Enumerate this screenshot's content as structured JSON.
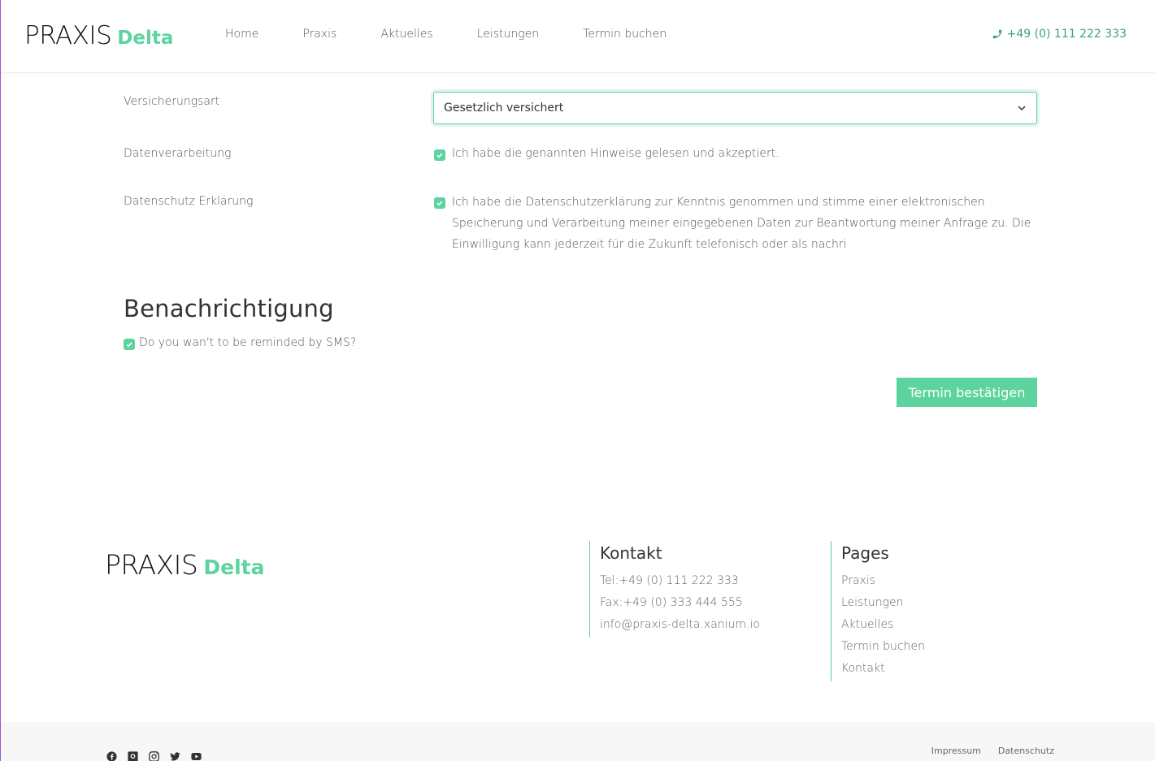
{
  "header": {
    "logo_word1": "PRAXIS",
    "logo_word2": "Delta",
    "nav": [
      "Home",
      "Praxis",
      "Aktuelles",
      "Leistungen",
      "Termin buchen"
    ],
    "phone": "+49 (0) 111 222 333"
  },
  "form": {
    "versicherung_label": "Versicherungsart",
    "versicherung_value": "Gesetzlich versichert",
    "datenverarbeitung_label": "Datenverarbeitung",
    "datenverarbeitung_text": "Ich habe die genannten Hinweise gelesen und akzeptiert.",
    "datenschutz_label": "Datenschutz Erklärung",
    "datenschutz_text": "Ich habe die Datenschutzerklärung zur Kenntnis genommen und stimme einer elektronischen Speicherung und Verarbeitung meiner eingegebenen Daten zur Beantwortung meiner Anfrage zu. Die Einwilligung kann jederzeit für die Zukunft telefonisch oder als nachri"
  },
  "notification": {
    "heading": "Benachrichtigung",
    "sms_label": "Do you wan't to be reminded by SMS?",
    "confirm_button": "Termin bestätigen"
  },
  "footer": {
    "logo_word1": "PRAXIS",
    "logo_word2": "Delta",
    "kontakt": {
      "title": "Kontakt",
      "items": [
        "Tel:+49 (0) 111 222 333",
        "Fax:+49 (0) 333 444 555",
        "info@praxis-delta.xanium.io"
      ]
    },
    "pages": {
      "title": "Pages",
      "items": [
        "Praxis",
        "Leistungen",
        "Aktuelles",
        "Termin buchen",
        "Kontakt"
      ]
    },
    "bottom_links": [
      "Impressum",
      "Datenschutz"
    ],
    "socials": [
      "facebook-icon",
      "github-icon",
      "instagram-icon",
      "twitter-icon",
      "youtube-icon"
    ]
  },
  "colors": {
    "accent": "#5dd39e",
    "phone": "#3d9e8c"
  }
}
